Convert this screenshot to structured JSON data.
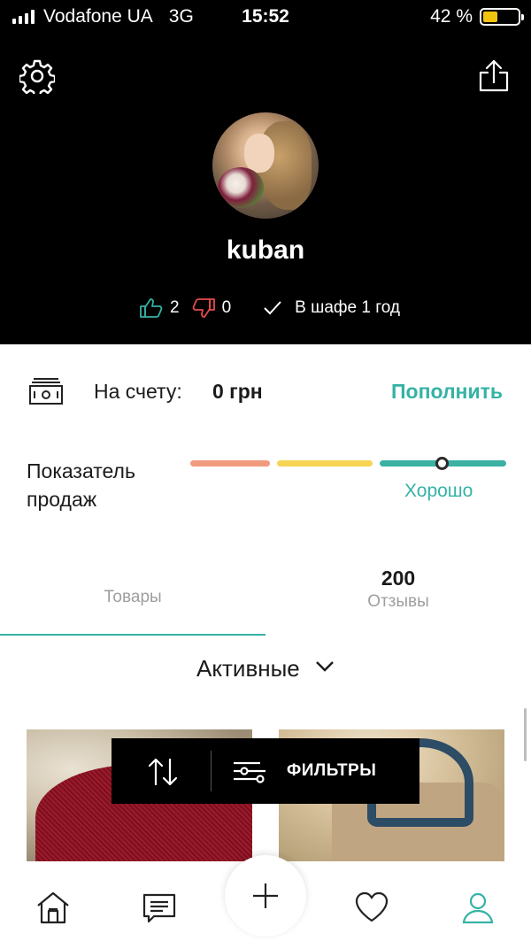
{
  "status_bar": {
    "carrier": "Vodafone UA",
    "network": "3G",
    "time": "15:52",
    "battery": "42 %",
    "battery_level": 0.42
  },
  "profile": {
    "username": "kuban",
    "likes": "2",
    "dislikes": "0",
    "membership": "В шафе 1 год"
  },
  "balance": {
    "label": "На счету:",
    "value": "0 грн",
    "topup_label": "Пополнить"
  },
  "sales_indicator": {
    "label": "Показатель продаж",
    "level_label": "Хорошо",
    "colors": [
      "#f19a7e",
      "#f7d554",
      "#3bb1a3"
    ]
  },
  "tabs": [
    {
      "label": "Товары",
      "count": "",
      "active": true
    },
    {
      "label": "Отзывы",
      "count": "200",
      "active": false
    }
  ],
  "listing": {
    "filter_title": "Активные",
    "filters_label": "ФИЛЬТРЫ"
  },
  "accent_color": "#35b2a6",
  "icons": {
    "top_left": "gear-icon",
    "top_right": "share-icon",
    "nav": [
      "home-icon",
      "chat-icon",
      "plus-icon",
      "heart-icon",
      "profile-icon"
    ]
  }
}
